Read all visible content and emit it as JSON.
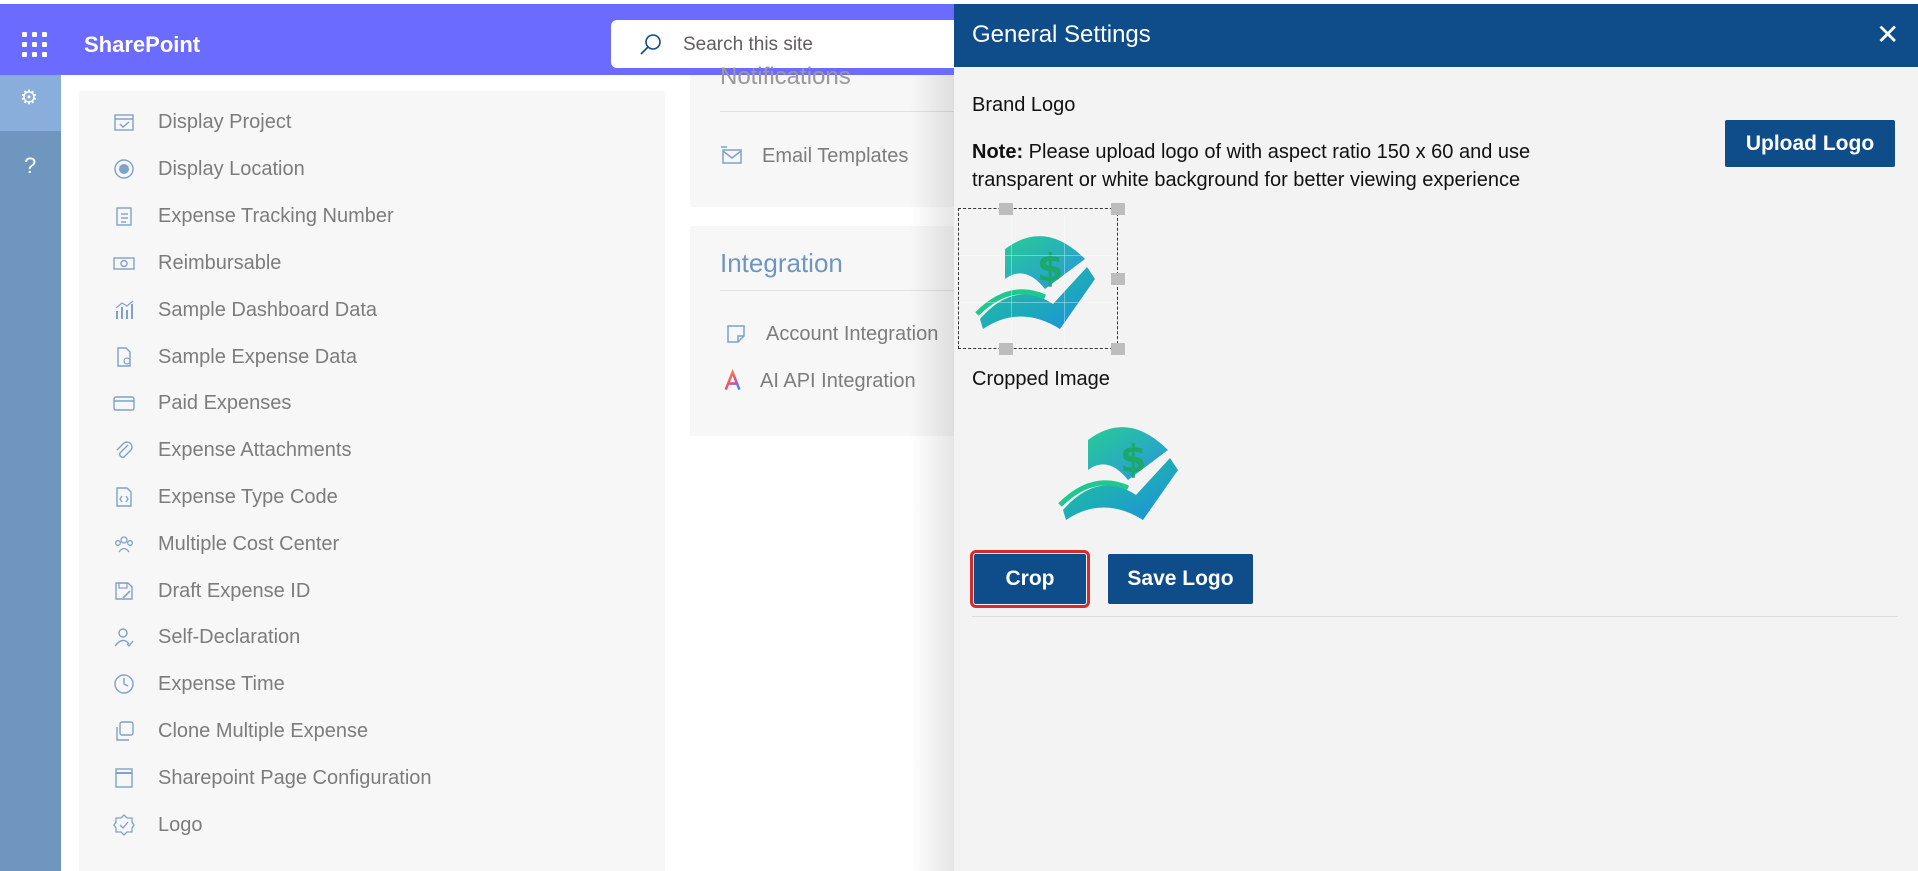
{
  "topbar": {
    "brand": "SharePoint",
    "search_placeholder": "Search this site"
  },
  "rail": {
    "items": [
      "gear-icon",
      "help-icon"
    ],
    "help_glyph": "?"
  },
  "settings_list": [
    {
      "label": "Display Project",
      "icon": "calendar-check-icon"
    },
    {
      "label": "Display Location",
      "icon": "radio-target-icon"
    },
    {
      "label": "Expense Tracking Number",
      "icon": "clipboard-list-icon"
    },
    {
      "label": "Reimbursable",
      "icon": "money-icon"
    },
    {
      "label": "Sample Dashboard Data",
      "icon": "bar-chart-icon"
    },
    {
      "label": "Sample Expense Data",
      "icon": "document-icon"
    },
    {
      "label": "Paid Expenses",
      "icon": "credit-card-icon"
    },
    {
      "label": "Expense Attachments",
      "icon": "paperclip-icon"
    },
    {
      "label": "Expense Type Code",
      "icon": "code-file-icon"
    },
    {
      "label": "Multiple Cost Center",
      "icon": "people-group-icon"
    },
    {
      "label": "Draft Expense ID",
      "icon": "save-edit-icon"
    },
    {
      "label": "Self-Declaration",
      "icon": "person-check-icon"
    },
    {
      "label": "Expense Time",
      "icon": "clock-icon"
    },
    {
      "label": "Clone Multiple Expense",
      "icon": "copy-icon"
    },
    {
      "label": "Sharepoint Page Configuration",
      "icon": "page-icon"
    },
    {
      "label": "Logo",
      "icon": "badge-gear-icon"
    }
  ],
  "notifications_card": {
    "partial_title": "Notifications",
    "items": [
      {
        "label": "Email Templates",
        "icon": "mail-icon"
      }
    ]
  },
  "integration_card": {
    "title": "Integration",
    "items": [
      {
        "label": "Account Integration",
        "icon": "sticky-note-icon"
      },
      {
        "label": "AI API Integration",
        "icon": "ai-logo-icon"
      }
    ]
  },
  "panel": {
    "title": "General Settings",
    "close_glyph": "✕",
    "brand_logo_label": "Brand Logo",
    "note_bold": "Note:",
    "note_text": " Please upload logo of with aspect ratio 150 x 60 and use transparent or white background for better viewing experience",
    "upload_button": "Upload Logo",
    "cropped_label": "Cropped Image",
    "crop_button": "Crop",
    "save_button": "Save Logo"
  },
  "colors": {
    "topbar": "#6b6cff",
    "panel_header": "#0e4c8a",
    "button": "#0e4c8a",
    "rail": "#6f96bf",
    "highlight": "#d52b2b",
    "logo_green": "#1ec98f",
    "logo_blue": "#1d8fe0"
  }
}
